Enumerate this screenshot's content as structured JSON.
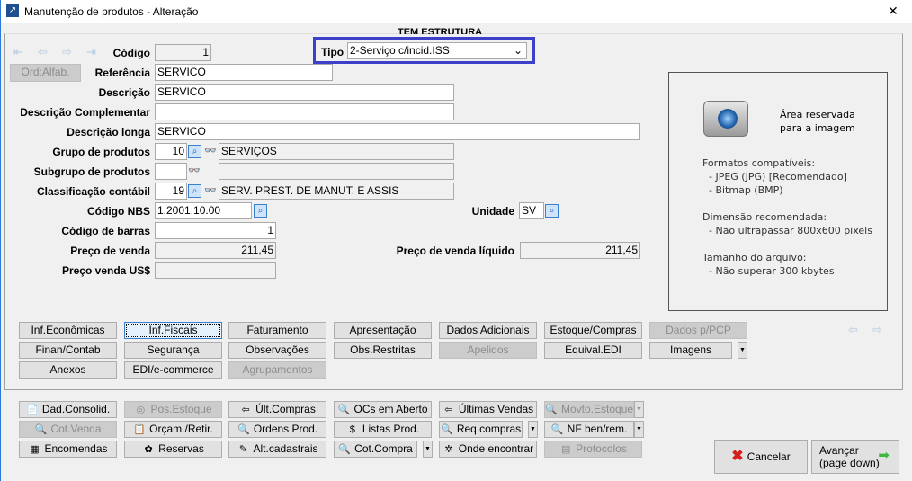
{
  "window": {
    "title": "Manutenção de produtos - Alteração",
    "close": "✕"
  },
  "banner": "TEM ESTRUTURA",
  "toolbar": {
    "ord_button": "Ord:Alfab."
  },
  "form": {
    "codigo": {
      "label": "Código",
      "value": "1"
    },
    "tipo": {
      "label": "Tipo",
      "value": "2-Serviço c/incid.ISS"
    },
    "referencia": {
      "label": "Referência",
      "value": "SERVICO"
    },
    "descricao": {
      "label": "Descrição",
      "value": "SERVICO"
    },
    "descricao_complementar": {
      "label": "Descrição Complementar",
      "value": ""
    },
    "descricao_longa": {
      "label": "Descrição longa",
      "value": "SERVICO"
    },
    "grupo": {
      "label": "Grupo de produtos",
      "value": "10",
      "desc": "SERVIÇOS"
    },
    "subgrupo": {
      "label": "Subgrupo de produtos",
      "value": "",
      "desc": ""
    },
    "classificacao": {
      "label": "Classificação contábil",
      "value": "19",
      "desc": "SERV. PREST. DE MANUT. E ASSIS"
    },
    "nbs": {
      "label": "Código NBS",
      "value": "1.2001.10.00"
    },
    "unidade": {
      "label": "Unidade",
      "value": "SV"
    },
    "barras": {
      "label": "Código de barras",
      "value": "1"
    },
    "preco_venda": {
      "label": "Preço de venda",
      "value": "211,45"
    },
    "preco_liquido": {
      "label": "Preço de venda líquido",
      "value": "211,45"
    },
    "preco_us": {
      "label": "Preço venda US$",
      "value": ""
    }
  },
  "image_area": {
    "reserved": "Área reservada\npara a imagem",
    "formats": "Formatos compatíveis:\n  - JPEG (JPG) [Recomendado]\n  - Bitmap (BMP)",
    "dimension": "Dimensão recomendada:\n  - Não ultrapassar 800x600 pixels",
    "size": "Tamanho do arquivo:\n  - Não superar 300 kbytes"
  },
  "tabs": [
    {
      "label": "Inf.Econômicas"
    },
    {
      "label": "Inf.Fiscais"
    },
    {
      "label": "Faturamento"
    },
    {
      "label": "Apresentação"
    },
    {
      "label": "Dados Adicionais"
    },
    {
      "label": "Estoque/Compras"
    },
    {
      "label": "Dados p/PCP"
    },
    {
      "label": "Finan/Contab"
    },
    {
      "label": "Segurança"
    },
    {
      "label": "Observações"
    },
    {
      "label": "Obs.Restritas"
    },
    {
      "label": "Apelidos"
    },
    {
      "label": "Equival.EDI"
    },
    {
      "label": "Imagens"
    },
    {
      "label": "Anexos"
    },
    {
      "label": "EDI/e-commerce"
    },
    {
      "label": "Agrupamentos"
    }
  ],
  "actions": [
    {
      "label": "Dad.Consolid.",
      "icon": "📄"
    },
    {
      "label": "Pos.Estoque",
      "icon": "◎"
    },
    {
      "label": "Últ.Compras",
      "icon": "⇦"
    },
    {
      "label": "OCs em Aberto",
      "icon": "🔍"
    },
    {
      "label": "Últimas Vendas",
      "icon": "⇦"
    },
    {
      "label": "Movto.Estoque",
      "icon": "🔍"
    },
    {
      "label": "Cot.Venda",
      "icon": "🔍"
    },
    {
      "label": "Orçam./Retir.",
      "icon": "📋"
    },
    {
      "label": "Ordens Prod.",
      "icon": "🔍"
    },
    {
      "label": "Listas Prod.",
      "icon": "$"
    },
    {
      "label": "Req.compras",
      "icon": "🔍"
    },
    {
      "label": "NF ben/rem.",
      "icon": "🔍"
    },
    {
      "label": "Encomendas",
      "icon": "▦"
    },
    {
      "label": "Reservas",
      "icon": "✿"
    },
    {
      "label": "Alt.cadastrais",
      "icon": "✎"
    },
    {
      "label": "Cot.Compra",
      "icon": "🔍"
    },
    {
      "label": "Onde encontrar",
      "icon": "✲"
    },
    {
      "label": "Protocolos",
      "icon": "▤"
    }
  ],
  "cancel": "Cancelar",
  "next": {
    "line1": "Avançar",
    "line2": "(page down)"
  },
  "colors": {
    "highlight": "#3c3fc8",
    "accent": "#2b79d6"
  }
}
